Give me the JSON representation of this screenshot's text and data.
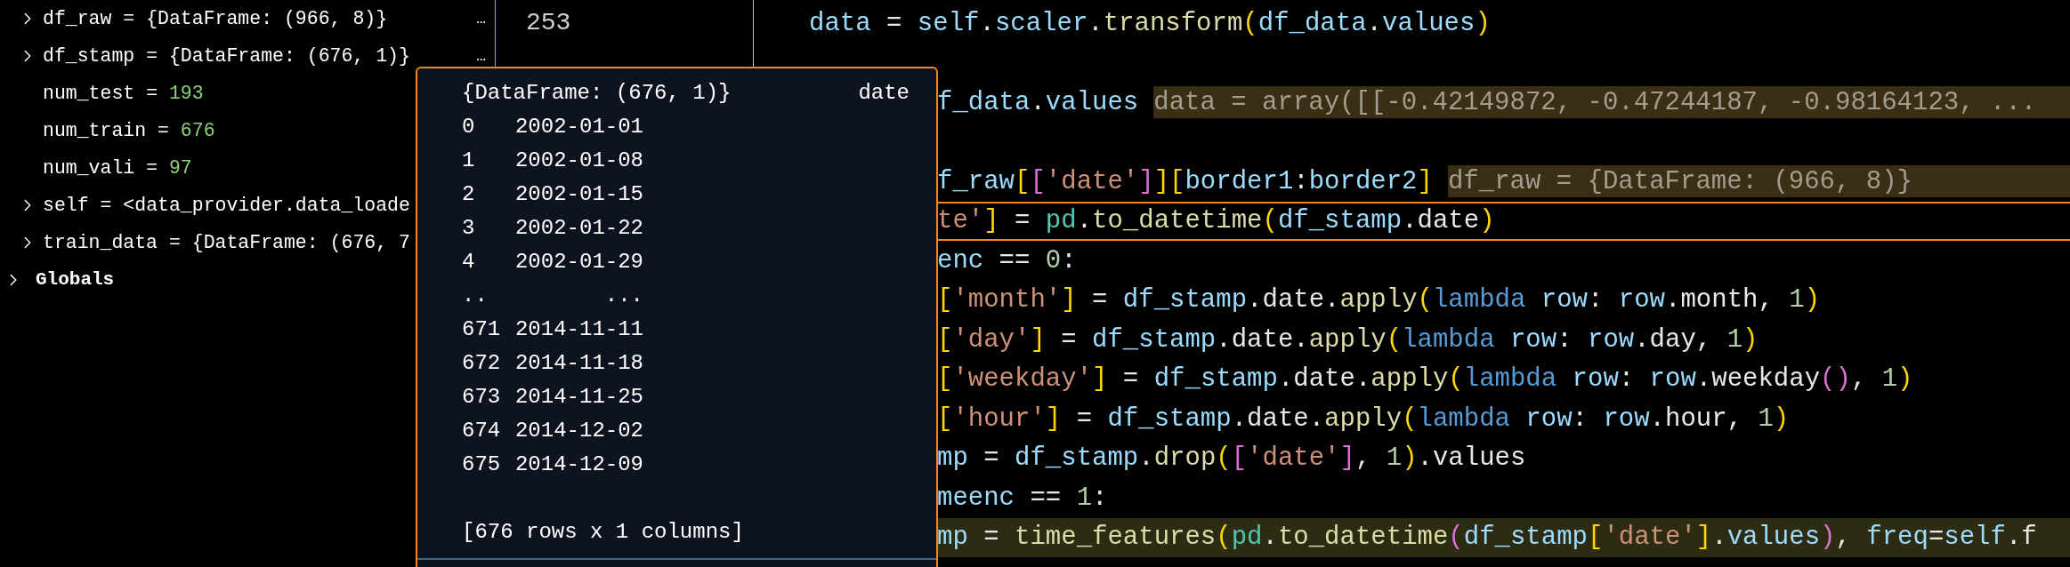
{
  "variables": {
    "items": [
      {
        "name": "df_raw",
        "operator": "=",
        "value": "{DataFrame: (966, 8)}",
        "kind": "object",
        "expandable": true,
        "more": "…"
      },
      {
        "name": "df_stamp",
        "operator": "=",
        "value": "{DataFrame: (676, 1)}",
        "kind": "object",
        "expandable": true,
        "more": "…"
      },
      {
        "name": "num_test",
        "operator": "=",
        "value": "193",
        "kind": "number",
        "expandable": false
      },
      {
        "name": "num_train",
        "operator": "=",
        "value": "676",
        "kind": "number",
        "expandable": false
      },
      {
        "name": "num_vali",
        "operator": "=",
        "value": "97",
        "kind": "number",
        "expandable": false
      },
      {
        "name": "self",
        "operator": "=",
        "value": "<data_provider.data_loade",
        "kind": "object",
        "expandable": true
      },
      {
        "name": "train_data",
        "operator": "=",
        "value": "{DataFrame: (676, 7",
        "kind": "object",
        "expandable": true
      }
    ],
    "groups": [
      {
        "label": "Globals",
        "expanded": false
      }
    ]
  },
  "editor": {
    "lines": [
      {
        "kind": "code",
        "number": "253",
        "current": false,
        "highlighted": false,
        "tokens": [
          {
            "kind": "var",
            "text": "data"
          },
          {
            "kind": "plain",
            "text": " = "
          },
          {
            "kind": "var",
            "text": "self"
          },
          {
            "kind": "plain",
            "text": "."
          },
          {
            "kind": "var",
            "text": "scaler"
          },
          {
            "kind": "plain",
            "text": "."
          },
          {
            "kind": "func",
            "text": "transform"
          },
          {
            "kind": "bracket",
            "text": "("
          },
          {
            "kind": "var",
            "text": "df_data"
          },
          {
            "kind": "plain",
            "text": "."
          },
          {
            "kind": "var",
            "text": "values"
          },
          {
            "kind": "bracket",
            "text": ")"
          }
        ]
      },
      {
        "kind": "blank"
      },
      {
        "kind": "code",
        "current": false,
        "highlighted": false,
        "tokens": [
          {
            "kind": "var",
            "text": "f_data"
          },
          {
            "kind": "plain",
            "text": "."
          },
          {
            "kind": "var",
            "text": "values"
          },
          {
            "kind": "inline",
            "text": "data = array([[-0.42149872, -0.47244187, -0.98164123, ..."
          }
        ]
      },
      {
        "kind": "blank"
      },
      {
        "kind": "code",
        "current": false,
        "highlighted": false,
        "tokens": [
          {
            "kind": "var",
            "text": "f_raw"
          },
          {
            "kind": "bracket",
            "text": "["
          },
          {
            "kind": "bracket2",
            "text": "["
          },
          {
            "kind": "string",
            "text": "'date'"
          },
          {
            "kind": "bracket2",
            "text": "]"
          },
          {
            "kind": "bracket",
            "text": "]["
          },
          {
            "kind": "var",
            "text": "border1"
          },
          {
            "kind": "plain",
            "text": ":"
          },
          {
            "kind": "var",
            "text": "border2"
          },
          {
            "kind": "bracket",
            "text": "]"
          },
          {
            "kind": "inline",
            "text": "df_raw = {DataFrame: (966, 8)}"
          }
        ]
      },
      {
        "kind": "code",
        "current": true,
        "highlighted": false,
        "tokens": [
          {
            "kind": "string",
            "text": "te'"
          },
          {
            "kind": "bracket",
            "text": "]"
          },
          {
            "kind": "plain",
            "text": " = "
          },
          {
            "kind": "module",
            "text": "pd"
          },
          {
            "kind": "plain",
            "text": "."
          },
          {
            "kind": "func",
            "text": "to_datetime"
          },
          {
            "kind": "bracket",
            "text": "("
          },
          {
            "kind": "var",
            "text": "df_stamp"
          },
          {
            "kind": "plain",
            "text": ".date"
          },
          {
            "kind": "bracket",
            "text": ")"
          }
        ]
      },
      {
        "kind": "code",
        "current": false,
        "highlighted": false,
        "tokens": [
          {
            "kind": "var",
            "text": "enc"
          },
          {
            "kind": "plain",
            "text": " == "
          },
          {
            "kind": "number",
            "text": "0"
          },
          {
            "kind": "plain",
            "text": ":"
          }
        ]
      },
      {
        "kind": "code",
        "current": false,
        "highlighted": false,
        "tokens": [
          {
            "kind": "bracket",
            "text": "["
          },
          {
            "kind": "string",
            "text": "'month'"
          },
          {
            "kind": "bracket",
            "text": "]"
          },
          {
            "kind": "plain",
            "text": " = "
          },
          {
            "kind": "var",
            "text": "df_stamp"
          },
          {
            "kind": "plain",
            "text": ".date."
          },
          {
            "kind": "func",
            "text": "apply"
          },
          {
            "kind": "bracket",
            "text": "("
          },
          {
            "kind": "keyword",
            "text": "lambda"
          },
          {
            "kind": "var",
            "text": " row"
          },
          {
            "kind": "plain",
            "text": ": "
          },
          {
            "kind": "var",
            "text": "row"
          },
          {
            "kind": "plain",
            "text": ".month, "
          },
          {
            "kind": "number",
            "text": "1"
          },
          {
            "kind": "bracket",
            "text": ")"
          }
        ]
      },
      {
        "kind": "code",
        "current": false,
        "highlighted": false,
        "tokens": [
          {
            "kind": "bracket",
            "text": "["
          },
          {
            "kind": "string",
            "text": "'day'"
          },
          {
            "kind": "bracket",
            "text": "]"
          },
          {
            "kind": "plain",
            "text": " = "
          },
          {
            "kind": "var",
            "text": "df_stamp"
          },
          {
            "kind": "plain",
            "text": ".date."
          },
          {
            "kind": "func",
            "text": "apply"
          },
          {
            "kind": "bracket",
            "text": "("
          },
          {
            "kind": "keyword",
            "text": "lambda"
          },
          {
            "kind": "var",
            "text": " row"
          },
          {
            "kind": "plain",
            "text": ": "
          },
          {
            "kind": "var",
            "text": "row"
          },
          {
            "kind": "plain",
            "text": ".day, "
          },
          {
            "kind": "number",
            "text": "1"
          },
          {
            "kind": "bracket",
            "text": ")"
          }
        ]
      },
      {
        "kind": "code",
        "current": false,
        "highlighted": false,
        "tokens": [
          {
            "kind": "bracket",
            "text": "["
          },
          {
            "kind": "string",
            "text": "'weekday'"
          },
          {
            "kind": "bracket",
            "text": "]"
          },
          {
            "kind": "plain",
            "text": " = "
          },
          {
            "kind": "var",
            "text": "df_stamp"
          },
          {
            "kind": "plain",
            "text": ".date."
          },
          {
            "kind": "func",
            "text": "apply"
          },
          {
            "kind": "bracket",
            "text": "("
          },
          {
            "kind": "keyword",
            "text": "lambda"
          },
          {
            "kind": "var",
            "text": " row"
          },
          {
            "kind": "plain",
            "text": ": "
          },
          {
            "kind": "var",
            "text": "row"
          },
          {
            "kind": "plain",
            "text": ".weekday"
          },
          {
            "kind": "bracket2",
            "text": "()"
          },
          {
            "kind": "plain",
            "text": ", "
          },
          {
            "kind": "number",
            "text": "1"
          },
          {
            "kind": "bracket",
            "text": ")"
          }
        ]
      },
      {
        "kind": "code",
        "current": false,
        "highlighted": false,
        "tokens": [
          {
            "kind": "bracket",
            "text": "["
          },
          {
            "kind": "string",
            "text": "'hour'"
          },
          {
            "kind": "bracket",
            "text": "]"
          },
          {
            "kind": "plain",
            "text": " = "
          },
          {
            "kind": "var",
            "text": "df_stamp"
          },
          {
            "kind": "plain",
            "text": ".date."
          },
          {
            "kind": "func",
            "text": "apply"
          },
          {
            "kind": "bracket",
            "text": "("
          },
          {
            "kind": "keyword",
            "text": "lambda"
          },
          {
            "kind": "var",
            "text": " row"
          },
          {
            "kind": "plain",
            "text": ": "
          },
          {
            "kind": "var",
            "text": "row"
          },
          {
            "kind": "plain",
            "text": ".hour, "
          },
          {
            "kind": "number",
            "text": "1"
          },
          {
            "kind": "bracket",
            "text": ")"
          }
        ]
      },
      {
        "kind": "code",
        "current": false,
        "highlighted": false,
        "tokens": [
          {
            "kind": "var",
            "text": "mp"
          },
          {
            "kind": "plain",
            "text": " = "
          },
          {
            "kind": "var",
            "text": "df_stamp"
          },
          {
            "kind": "plain",
            "text": "."
          },
          {
            "kind": "func",
            "text": "drop"
          },
          {
            "kind": "bracket",
            "text": "("
          },
          {
            "kind": "bracket2",
            "text": "["
          },
          {
            "kind": "string",
            "text": "'date'"
          },
          {
            "kind": "bracket2",
            "text": "]"
          },
          {
            "kind": "plain",
            "text": ", "
          },
          {
            "kind": "number",
            "text": "1"
          },
          {
            "kind": "bracket",
            "text": ")"
          },
          {
            "kind": "plain",
            "text": ".values"
          }
        ]
      },
      {
        "kind": "code",
        "current": false,
        "highlighted": false,
        "tokens": [
          {
            "kind": "var",
            "text": "meenc"
          },
          {
            "kind": "plain",
            "text": " == "
          },
          {
            "kind": "number",
            "text": "1"
          },
          {
            "kind": "plain",
            "text": ":"
          }
        ]
      },
      {
        "kind": "code",
        "current": false,
        "highlighted": true,
        "tokens": [
          {
            "kind": "var",
            "text": "mp"
          },
          {
            "kind": "plain",
            "text": " = "
          },
          {
            "kind": "func",
            "text": "time_features"
          },
          {
            "kind": "bracket",
            "text": "("
          },
          {
            "kind": "module",
            "text": "pd"
          },
          {
            "kind": "plain",
            "text": "."
          },
          {
            "kind": "func",
            "text": "to_datetime"
          },
          {
            "kind": "bracket2",
            "text": "("
          },
          {
            "kind": "var",
            "text": "df_stamp"
          },
          {
            "kind": "bracket",
            "text": "["
          },
          {
            "kind": "string",
            "text": "'date'"
          },
          {
            "kind": "bracket",
            "text": "]"
          },
          {
            "kind": "plain",
            "text": "."
          },
          {
            "kind": "var",
            "text": "values"
          },
          {
            "kind": "bracket2",
            "text": ")"
          },
          {
            "kind": "plain",
            "text": ", "
          },
          {
            "kind": "var",
            "text": "freq"
          },
          {
            "kind": "plain",
            "text": "="
          },
          {
            "kind": "var",
            "text": "self"
          },
          {
            "kind": "plain",
            "text": ".f"
          }
        ]
      }
    ]
  },
  "popup": {
    "header": "{DataFrame: (676, 1)}",
    "column": "date",
    "rows": [
      {
        "index": "0",
        "value": "2002-01-01"
      },
      {
        "index": "1",
        "value": "2002-01-08"
      },
      {
        "index": "2",
        "value": "2002-01-15"
      },
      {
        "index": "3",
        "value": "2002-01-22"
      },
      {
        "index": "4",
        "value": "2002-01-29"
      },
      {
        "index": "..",
        "value": "..."
      },
      {
        "index": "671",
        "value": "2014-11-11"
      },
      {
        "index": "672",
        "value": "2014-11-18"
      },
      {
        "index": "673",
        "value": "2014-11-25"
      },
      {
        "index": "674",
        "value": "2014-12-02"
      },
      {
        "index": "675",
        "value": "2014-12-09"
      }
    ],
    "footer": "[676 rows x 1 columns]"
  }
}
